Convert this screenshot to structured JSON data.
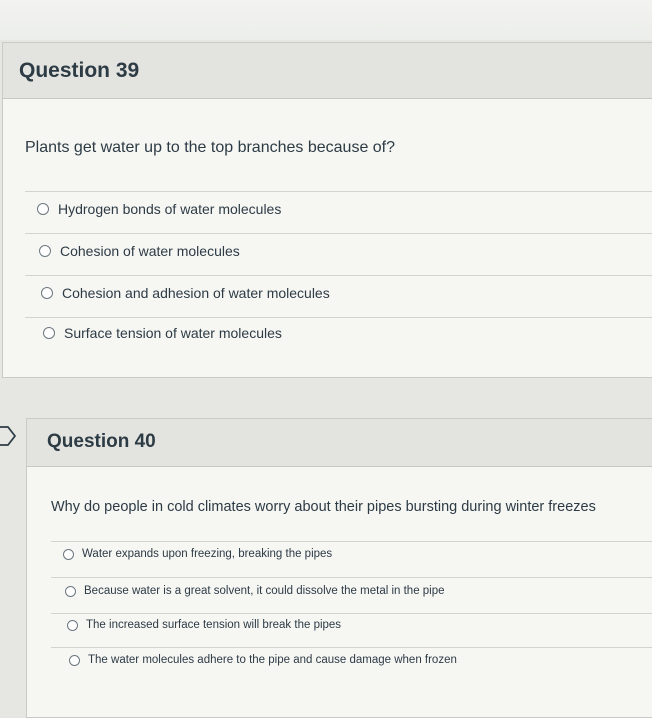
{
  "q39": {
    "title": "Question 39",
    "text": "Plants get water up to the top branches because of?",
    "answers": [
      "Hydrogen bonds of water molecules",
      "Cohesion of water molecules",
      "Cohesion and adhesion of water molecules",
      "Surface tension of water molecules"
    ]
  },
  "q40": {
    "title": "Question 40",
    "text": "Why do people in cold climates worry about their pipes bursting during winter freezes",
    "answers": [
      "Water expands upon freezing, breaking the pipes",
      "Because water is a great solvent, it could dissolve the metal in the pipe",
      "The increased surface tension will break the pipes",
      "The water molecules adhere to the pipe and cause damage when frozen"
    ]
  },
  "colors": {
    "text": "#2d3b45",
    "header_bg": "#e3e4e0",
    "card_bg": "#f6f6f3",
    "radio_border": "#6b7780"
  },
  "icons": {
    "question_marker": "bookmark-arrow-icon"
  }
}
